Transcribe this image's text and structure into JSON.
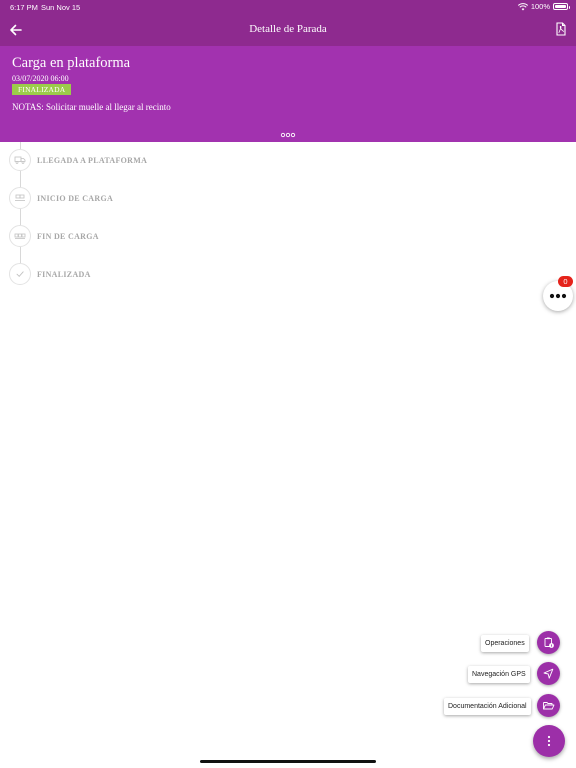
{
  "status_bar": {
    "time": "6:17 PM",
    "date": "Sun Nov 15",
    "battery": "100%"
  },
  "nav": {
    "title": "Detalle de Parada",
    "back_icon": "arrow-left-icon",
    "action_icon": "pdf-file-icon"
  },
  "stop": {
    "title": "Carga en plataforma",
    "datetime": "03/07/2020 06:00",
    "status": "FINALIZADA",
    "notes": "NOTAS: Solicitar muelle al llegar al recinto"
  },
  "timeline": [
    {
      "label": "LLEGADA A PLATAFORMA",
      "icon": "truck-icon"
    },
    {
      "label": "INICIO DE CARGA",
      "icon": "load-start-icon"
    },
    {
      "label": "FIN DE CARGA",
      "icon": "load-end-icon"
    },
    {
      "label": "FINALIZADA",
      "icon": "check-icon"
    }
  ],
  "notifications": {
    "count": "0"
  },
  "speed_dial": [
    {
      "label": "Operaciones",
      "icon": "clipboard-icon"
    },
    {
      "label": "Navegación GPS",
      "icon": "navigation-icon"
    },
    {
      "label": "Documentación Adicional",
      "icon": "folder-open-icon"
    }
  ],
  "colors": {
    "primary": "#8e2a8f",
    "header": "#a232af",
    "badge": "#9ccc4a",
    "notification": "#e5231b"
  }
}
